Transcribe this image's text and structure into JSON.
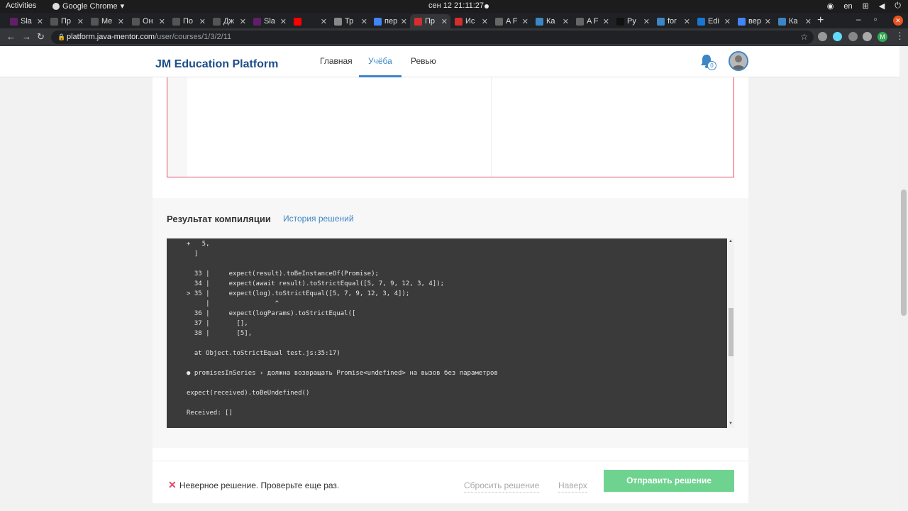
{
  "os": {
    "activities": "Activities",
    "app_name": "Google Chrome",
    "clock": "сен 12  21:11:27",
    "lang": "en"
  },
  "tabs": [
    {
      "title": "Sla",
      "color": "#611f69"
    },
    {
      "title": "Пр",
      "color": "#555555"
    },
    {
      "title": "Me",
      "color": "#555555"
    },
    {
      "title": "Он",
      "color": "#555555"
    },
    {
      "title": "По",
      "color": "#555555"
    },
    {
      "title": "Дж",
      "color": "#555555"
    },
    {
      "title": "Sla",
      "color": "#611f69"
    },
    {
      "title": "",
      "color": "#ff0000"
    },
    {
      "title": "Тр",
      "color": "#888888"
    },
    {
      "title": "пер",
      "color": "#4285f4"
    },
    {
      "title": "Пр",
      "color": "#d32f2f"
    },
    {
      "title": "Ис",
      "color": "#d32f2f"
    },
    {
      "title": "A F",
      "color": "#666666"
    },
    {
      "title": "Ка",
      "color": "#3d86c6"
    },
    {
      "title": "A F",
      "color": "#666666"
    },
    {
      "title": "Ру",
      "color": "#111111"
    },
    {
      "title": "for",
      "color": "#3d86c6"
    },
    {
      "title": "Edi",
      "color": "#1976d2"
    },
    {
      "title": "вер",
      "color": "#4285f4"
    },
    {
      "title": "Ка",
      "color": "#3d86c6"
    }
  ],
  "browser": {
    "url_host": "platform.java-mentor.com",
    "url_path": "/user/courses/1/3/2/11",
    "profile_initial": "M"
  },
  "header": {
    "logo": "JM Education Platform",
    "nav": [
      "Главная",
      "Учёба",
      "Ревью"
    ],
    "notifications": "0"
  },
  "result": {
    "title": "Результат компиляции",
    "history_link": "История решений",
    "console_lines": [
      "+   5,",
      "  ]",
      "",
      "  33 |     expect(result).toBeInstanceOf(Promise);",
      "  34 |     expect(await result).toStrictEqual([5, 7, 9, 12, 3, 4]);",
      "> 35 |     expect(log).toStrictEqual([5, 7, 9, 12, 3, 4]);",
      "     |                 ^",
      "  36 |     expect(logParams).toStrictEqual([",
      "  37 |       [],",
      "  38 |       [5],",
      "",
      "  at Object.toStrictEqual test.js:35:17)",
      "",
      "● promisesInSeries › должна возвращать Promise<undefined> на вызов без параметров",
      "",
      "expect(received).toBeUndefined()",
      "",
      "Received: []"
    ]
  },
  "footer": {
    "error_text": "Неверное решение. Проверьте еще раз.",
    "reset_label": "Сбросить решение",
    "top_label": "Наверх",
    "submit_label": "Отправить решение"
  }
}
